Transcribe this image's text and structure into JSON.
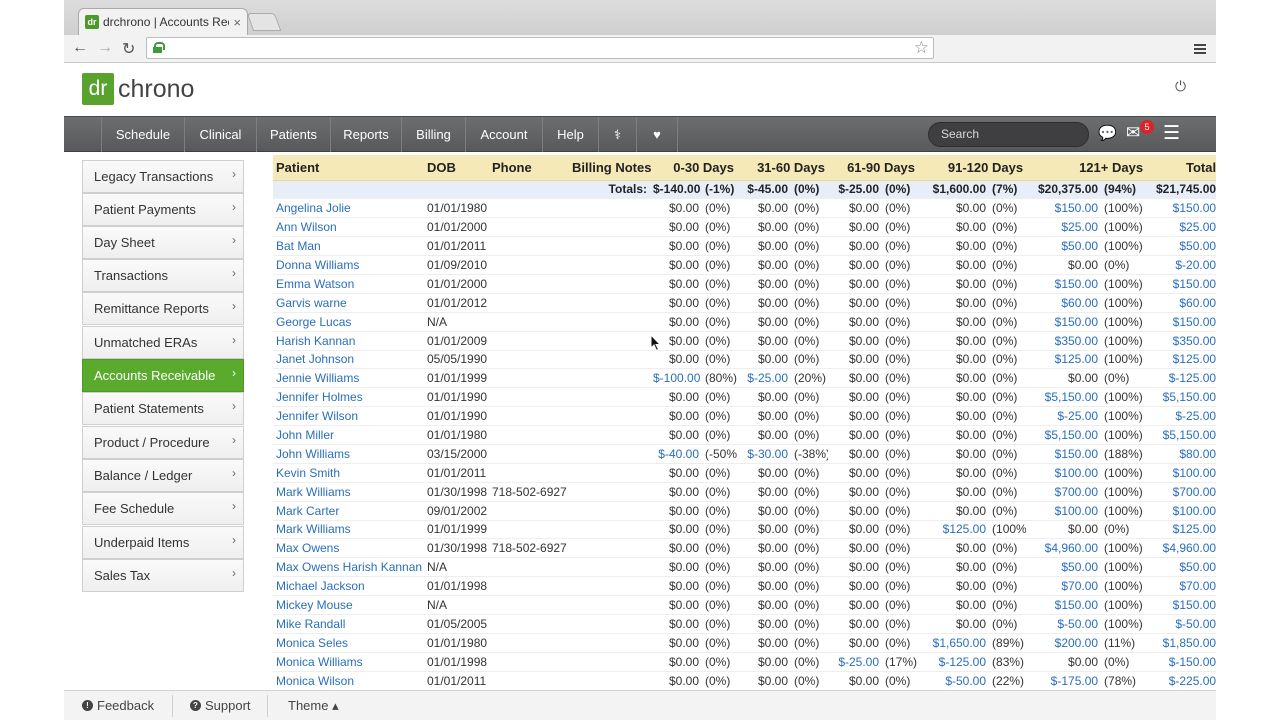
{
  "browser": {
    "tab_title": "drchrono | Accounts Rece",
    "tab_favicon": "dr",
    "tab_close": "×",
    "nav_back": "←",
    "nav_forward": "→",
    "nav_reload": "↻",
    "bookmark_star": "☆"
  },
  "header": {
    "logo_dr": "dr",
    "logo_chrono": "chrono",
    "power_icon": "⏻"
  },
  "nav": {
    "items": [
      {
        "label": "Schedule"
      },
      {
        "label": "Clinical"
      },
      {
        "label": "Patients"
      },
      {
        "label": "Reports"
      },
      {
        "label": "Billing"
      },
      {
        "label": "Account"
      },
      {
        "label": "Help"
      },
      {
        "label": "⚕"
      },
      {
        "label": "♥"
      }
    ],
    "search_placeholder": "Search",
    "badge_count": "5",
    "chat_icon": "💬",
    "mail_icon": "✉",
    "menu_icon": "☰"
  },
  "sidebar": {
    "items": [
      {
        "label": "Legacy Transactions"
      },
      {
        "label": "Patient Payments"
      },
      {
        "label": "Day Sheet"
      },
      {
        "label": "Transactions"
      },
      {
        "label": "Remittance Reports"
      },
      {
        "label": "Unmatched ERAs"
      },
      {
        "label": "Accounts Receivable"
      },
      {
        "label": "Patient Statements"
      },
      {
        "label": "Product / Procedure"
      },
      {
        "label": "Balance / Ledger"
      },
      {
        "label": "Fee Schedule"
      },
      {
        "label": "Underpaid Items"
      },
      {
        "label": "Sales Tax"
      }
    ],
    "active_index": 6,
    "chevron": "›"
  },
  "table": {
    "headers": [
      "Patient",
      "DOB",
      "Phone",
      "Billing Notes",
      "0-30 Days",
      "31-60 Days",
      "61-90 Days",
      "91-120 Days",
      "121+ Days",
      "Total"
    ],
    "totals": {
      "label": "Totals:",
      "d0": "$-140.00",
      "p0": "(-1%)",
      "d1": "$-45.00",
      "p1": "(0%)",
      "d2": "$-25.00",
      "p2": "(0%)",
      "d3": "$1,600.00",
      "p3": "(7%)",
      "d4": "$20,375.00",
      "p4": "(94%)",
      "total": "$21,745.00"
    },
    "rows": [
      {
        "name": "Angelina Jolie",
        "dob": "01/01/1980",
        "phone": "",
        "c": [
          [
            "$0.00",
            "(0%)"
          ],
          [
            "$0.00",
            "(0%)"
          ],
          [
            "$0.00",
            "(0%)"
          ],
          [
            "$0.00",
            "(0%)"
          ],
          [
            "$150.00",
            "(100%)"
          ]
        ],
        "total": "$150.00"
      },
      {
        "name": "Ann Wilson",
        "dob": "01/01/2000",
        "phone": "",
        "c": [
          [
            "$0.00",
            "(0%)"
          ],
          [
            "$0.00",
            "(0%)"
          ],
          [
            "$0.00",
            "(0%)"
          ],
          [
            "$0.00",
            "(0%)"
          ],
          [
            "$25.00",
            "(100%)"
          ]
        ],
        "total": "$25.00"
      },
      {
        "name": "Bat Man",
        "dob": "01/01/2011",
        "phone": "",
        "c": [
          [
            "$0.00",
            "(0%)"
          ],
          [
            "$0.00",
            "(0%)"
          ],
          [
            "$0.00",
            "(0%)"
          ],
          [
            "$0.00",
            "(0%)"
          ],
          [
            "$50.00",
            "(100%)"
          ]
        ],
        "total": "$50.00"
      },
      {
        "name": "Donna Williams",
        "dob": "01/09/2010",
        "phone": "",
        "c": [
          [
            "$0.00",
            "(0%)"
          ],
          [
            "$0.00",
            "(0%)"
          ],
          [
            "$0.00",
            "(0%)"
          ],
          [
            "$0.00",
            "(0%)"
          ],
          [
            "$0.00",
            "(0%)"
          ]
        ],
        "total": "$-20.00"
      },
      {
        "name": "Emma Watson",
        "dob": "01/01/2000",
        "phone": "",
        "c": [
          [
            "$0.00",
            "(0%)"
          ],
          [
            "$0.00",
            "(0%)"
          ],
          [
            "$0.00",
            "(0%)"
          ],
          [
            "$0.00",
            "(0%)"
          ],
          [
            "$150.00",
            "(100%)"
          ]
        ],
        "total": "$150.00"
      },
      {
        "name": "Garvis warne",
        "dob": "01/01/2012",
        "phone": "",
        "c": [
          [
            "$0.00",
            "(0%)"
          ],
          [
            "$0.00",
            "(0%)"
          ],
          [
            "$0.00",
            "(0%)"
          ],
          [
            "$0.00",
            "(0%)"
          ],
          [
            "$60.00",
            "(100%)"
          ]
        ],
        "total": "$60.00"
      },
      {
        "name": "George Lucas",
        "dob": "N/A",
        "phone": "",
        "c": [
          [
            "$0.00",
            "(0%)"
          ],
          [
            "$0.00",
            "(0%)"
          ],
          [
            "$0.00",
            "(0%)"
          ],
          [
            "$0.00",
            "(0%)"
          ],
          [
            "$150.00",
            "(100%)"
          ]
        ],
        "total": "$150.00"
      },
      {
        "name": "Harish Kannan",
        "dob": "01/01/2009",
        "phone": "",
        "c": [
          [
            "$0.00",
            "(0%)"
          ],
          [
            "$0.00",
            "(0%)"
          ],
          [
            "$0.00",
            "(0%)"
          ],
          [
            "$0.00",
            "(0%)"
          ],
          [
            "$350.00",
            "(100%)"
          ]
        ],
        "total": "$350.00"
      },
      {
        "name": "Janet Johnson",
        "dob": "05/05/1990",
        "phone": "",
        "c": [
          [
            "$0.00",
            "(0%)"
          ],
          [
            "$0.00",
            "(0%)"
          ],
          [
            "$0.00",
            "(0%)"
          ],
          [
            "$0.00",
            "(0%)"
          ],
          [
            "$125.00",
            "(100%)"
          ]
        ],
        "total": "$125.00"
      },
      {
        "name": "Jennie Williams",
        "dob": "01/01/1999",
        "phone": "",
        "c": [
          [
            "$-100.00",
            "(80%)"
          ],
          [
            "$-25.00",
            "(20%)"
          ],
          [
            "$0.00",
            "(0%)"
          ],
          [
            "$0.00",
            "(0%)"
          ],
          [
            "$0.00",
            "(0%)"
          ]
        ],
        "total": "$-125.00"
      },
      {
        "name": "Jennifer Holmes",
        "dob": "01/01/1990",
        "phone": "",
        "c": [
          [
            "$0.00",
            "(0%)"
          ],
          [
            "$0.00",
            "(0%)"
          ],
          [
            "$0.00",
            "(0%)"
          ],
          [
            "$0.00",
            "(0%)"
          ],
          [
            "$5,150.00",
            "(100%)"
          ]
        ],
        "total": "$5,150.00"
      },
      {
        "name": "Jennifer Wilson",
        "dob": "01/01/1990",
        "phone": "",
        "c": [
          [
            "$0.00",
            "(0%)"
          ],
          [
            "$0.00",
            "(0%)"
          ],
          [
            "$0.00",
            "(0%)"
          ],
          [
            "$0.00",
            "(0%)"
          ],
          [
            "$-25.00",
            "(100%)"
          ]
        ],
        "total": "$-25.00"
      },
      {
        "name": "John Miller",
        "dob": "01/01/1980",
        "phone": "",
        "c": [
          [
            "$0.00",
            "(0%)"
          ],
          [
            "$0.00",
            "(0%)"
          ],
          [
            "$0.00",
            "(0%)"
          ],
          [
            "$0.00",
            "(0%)"
          ],
          [
            "$5,150.00",
            "(100%)"
          ]
        ],
        "total": "$5,150.00"
      },
      {
        "name": "John Williams",
        "dob": "03/15/2000",
        "phone": "",
        "c": [
          [
            "$-40.00",
            "(-50%)"
          ],
          [
            "$-30.00",
            "(-38%)"
          ],
          [
            "$0.00",
            "(0%)"
          ],
          [
            "$0.00",
            "(0%)"
          ],
          [
            "$150.00",
            "(188%)"
          ]
        ],
        "total": "$80.00"
      },
      {
        "name": "Kevin Smith",
        "dob": "01/01/2011",
        "phone": "",
        "c": [
          [
            "$0.00",
            "(0%)"
          ],
          [
            "$0.00",
            "(0%)"
          ],
          [
            "$0.00",
            "(0%)"
          ],
          [
            "$0.00",
            "(0%)"
          ],
          [
            "$100.00",
            "(100%)"
          ]
        ],
        "total": "$100.00"
      },
      {
        "name": "Mark Williams",
        "dob": "01/30/1998",
        "phone": "718-502-6927",
        "c": [
          [
            "$0.00",
            "(0%)"
          ],
          [
            "$0.00",
            "(0%)"
          ],
          [
            "$0.00",
            "(0%)"
          ],
          [
            "$0.00",
            "(0%)"
          ],
          [
            "$700.00",
            "(100%)"
          ]
        ],
        "total": "$700.00"
      },
      {
        "name": "Mark Carter",
        "dob": "09/01/2002",
        "phone": "",
        "c": [
          [
            "$0.00",
            "(0%)"
          ],
          [
            "$0.00",
            "(0%)"
          ],
          [
            "$0.00",
            "(0%)"
          ],
          [
            "$0.00",
            "(0%)"
          ],
          [
            "$100.00",
            "(100%)"
          ]
        ],
        "total": "$100.00"
      },
      {
        "name": "Mark Williams",
        "dob": "01/01/1999",
        "phone": "",
        "c": [
          [
            "$0.00",
            "(0%)"
          ],
          [
            "$0.00",
            "(0%)"
          ],
          [
            "$0.00",
            "(0%)"
          ],
          [
            "$125.00",
            "(100%)"
          ],
          [
            "$0.00",
            "(0%)"
          ]
        ],
        "total": "$125.00"
      },
      {
        "name": "Max Owens",
        "dob": "01/30/1998",
        "phone": "718-502-6927",
        "c": [
          [
            "$0.00",
            "(0%)"
          ],
          [
            "$0.00",
            "(0%)"
          ],
          [
            "$0.00",
            "(0%)"
          ],
          [
            "$0.00",
            "(0%)"
          ],
          [
            "$4,960.00",
            "(100%)"
          ]
        ],
        "total": "$4,960.00"
      },
      {
        "name": "Max Owens Harish Kannan",
        "dob": "N/A",
        "phone": "",
        "c": [
          [
            "$0.00",
            "(0%)"
          ],
          [
            "$0.00",
            "(0%)"
          ],
          [
            "$0.00",
            "(0%)"
          ],
          [
            "$0.00",
            "(0%)"
          ],
          [
            "$50.00",
            "(100%)"
          ]
        ],
        "total": "$50.00"
      },
      {
        "name": "Michael Jackson",
        "dob": "01/01/1998",
        "phone": "",
        "c": [
          [
            "$0.00",
            "(0%)"
          ],
          [
            "$0.00",
            "(0%)"
          ],
          [
            "$0.00",
            "(0%)"
          ],
          [
            "$0.00",
            "(0%)"
          ],
          [
            "$70.00",
            "(100%)"
          ]
        ],
        "total": "$70.00"
      },
      {
        "name": "Mickey Mouse",
        "dob": "N/A",
        "phone": "",
        "c": [
          [
            "$0.00",
            "(0%)"
          ],
          [
            "$0.00",
            "(0%)"
          ],
          [
            "$0.00",
            "(0%)"
          ],
          [
            "$0.00",
            "(0%)"
          ],
          [
            "$150.00",
            "(100%)"
          ]
        ],
        "total": "$150.00"
      },
      {
        "name": "Mike Randall",
        "dob": "01/05/2005",
        "phone": "",
        "c": [
          [
            "$0.00",
            "(0%)"
          ],
          [
            "$0.00",
            "(0%)"
          ],
          [
            "$0.00",
            "(0%)"
          ],
          [
            "$0.00",
            "(0%)"
          ],
          [
            "$-50.00",
            "(100%)"
          ]
        ],
        "total": "$-50.00"
      },
      {
        "name": "Monica Seles",
        "dob": "01/01/1980",
        "phone": "",
        "c": [
          [
            "$0.00",
            "(0%)"
          ],
          [
            "$0.00",
            "(0%)"
          ],
          [
            "$0.00",
            "(0%)"
          ],
          [
            "$1,650.00",
            "(89%)"
          ],
          [
            "$200.00",
            "(11%)"
          ]
        ],
        "total": "$1,850.00"
      },
      {
        "name": "Monica Williams",
        "dob": "01/01/1998",
        "phone": "",
        "c": [
          [
            "$0.00",
            "(0%)"
          ],
          [
            "$0.00",
            "(0%)"
          ],
          [
            "$-25.00",
            "(17%)"
          ],
          [
            "$-125.00",
            "(83%)"
          ],
          [
            "$0.00",
            "(0%)"
          ]
        ],
        "total": "$-150.00"
      },
      {
        "name": "Monica Wilson",
        "dob": "01/01/2011",
        "phone": "",
        "c": [
          [
            "$0.00",
            "(0%)"
          ],
          [
            "$0.00",
            "(0%)"
          ],
          [
            "$0.00",
            "(0%)"
          ],
          [
            "$-50.00",
            "(22%)"
          ],
          [
            "$-175.00",
            "(78%)"
          ]
        ],
        "total": "$-225.00"
      }
    ]
  },
  "footer": {
    "feedback": "Feedback",
    "support": "Support",
    "theme": "Theme ▴"
  },
  "colors": {
    "accent_green": "#5aaa2e",
    "link_blue": "#2a6ebb",
    "header_yellow": "#f6e9b8"
  }
}
